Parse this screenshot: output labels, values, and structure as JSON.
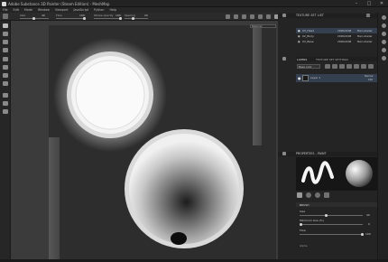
{
  "window": {
    "title": "Adobe Substance 3D Painter (Steam Edition) - MeshMap",
    "buttons": [
      "–",
      "□",
      "✕"
    ]
  },
  "menu": [
    "File",
    "Edit",
    "Mode",
    "Window",
    "Viewport",
    "JavaScript",
    "Python",
    "Help"
  ],
  "options": {
    "size_label": "Size",
    "size_value": "40",
    "flow_label": "Flow",
    "flow_value": "100",
    "stroke_opacity_label": "Stroke opacity",
    "stroke_opacity_value": "100",
    "spacing_label": "Spacing",
    "spacing_value": "20"
  },
  "viewport": {
    "dropdown": "Material"
  },
  "texture_set_list": {
    "title": "TEXTURE SET LIST",
    "rows": [
      {
        "name": "03_Head",
        "res": "2048x2048",
        "shader": "Main shader",
        "selected": true
      },
      {
        "name": "02_Body",
        "res": "2048x2048",
        "shader": "Main shader",
        "selected": false
      },
      {
        "name": "03_Base",
        "res": "2048x2048",
        "shader": "Main shader",
        "selected": false
      }
    ]
  },
  "layers": {
    "tabs": [
      "LAYERS",
      "TEXTURE SET SETTINGS"
    ],
    "base_color": "Base color",
    "layer_name": "Layer 1",
    "blend": "Normal",
    "opacity": "100"
  },
  "properties": {
    "title": "PROPERTIES - PAINT",
    "section": "BRUSH",
    "size_label": "Size",
    "size_value": "40",
    "min_size_label": "Minimum size (%)",
    "min_size_value": "0",
    "flow_label": "Flow",
    "flow_value": "100",
    "alpha_section": "Alpha"
  },
  "icons": {
    "brush": "brush-icon",
    "eraser": "eraser-icon",
    "projection": "projection-icon",
    "fill": "fill-icon",
    "picker": "color-picker-icon",
    "smudge": "smudge-icon",
    "clone": "clone-icon"
  }
}
